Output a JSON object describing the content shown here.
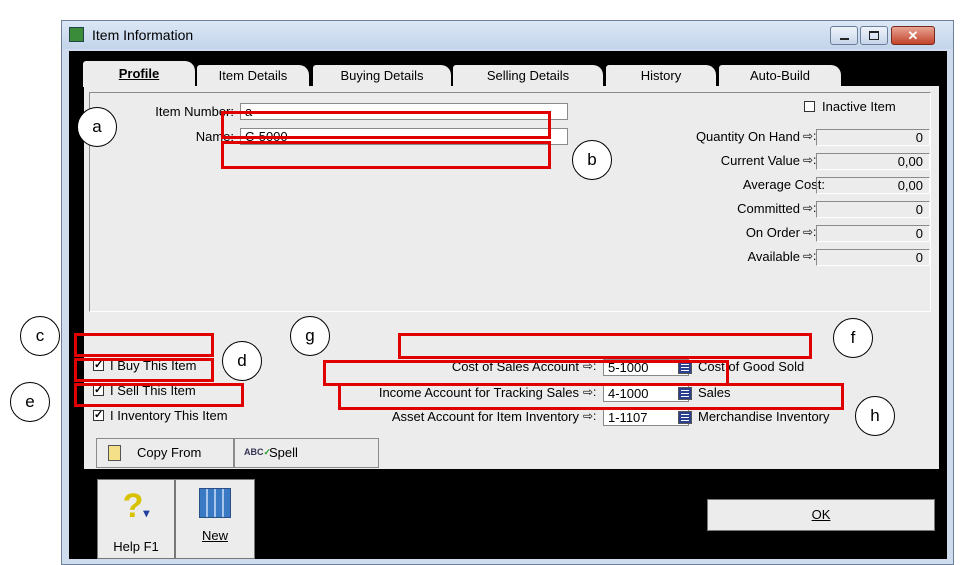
{
  "window": {
    "title": "Item Information"
  },
  "tabs": [
    {
      "label": "Profile"
    },
    {
      "label": "Item Details"
    },
    {
      "label": "Buying Details"
    },
    {
      "label": "Selling Details"
    },
    {
      "label": "History"
    },
    {
      "label": "Auto-Build"
    }
  ],
  "profile": {
    "item_number_label": "Item Number:",
    "item_number_value": "a",
    "name_label": "Name:",
    "name_value": "C-5000",
    "inactive_label": "Inactive Item",
    "inactive_checked": false
  },
  "stats": [
    {
      "label": "Quantity On Hand",
      "value": "0",
      "drilldown": true
    },
    {
      "label": "Current Value",
      "value": "0,00",
      "drilldown": true
    },
    {
      "label": "Average Cost:",
      "value": "0,00",
      "drilldown": false
    },
    {
      "label": "Committed",
      "value": "0",
      "drilldown": true
    },
    {
      "label": "On Order",
      "value": "0",
      "drilldown": true
    },
    {
      "label": "Available",
      "value": "0",
      "drilldown": true
    }
  ],
  "options": [
    {
      "label": "I Buy This Item",
      "checked": true
    },
    {
      "label": "I Sell This Item",
      "checked": true
    },
    {
      "label": "I Inventory This Item",
      "checked": true
    }
  ],
  "accounts": [
    {
      "label": "Cost of Sales Account",
      "number": "5-1000",
      "name": "Cost of Good Sold"
    },
    {
      "label": "Income Account for Tracking Sales",
      "number": "4-1000",
      "name": "Sales"
    },
    {
      "label": "Asset Account for Item Inventory",
      "number": "1-1107",
      "name": "Merchandise Inventory"
    }
  ],
  "buttons": {
    "copy_from": "Copy From",
    "spell": "Spell",
    "help": "Help F1",
    "new": "New",
    "ok": "OK"
  },
  "annotations": [
    "a",
    "b",
    "c",
    "d",
    "e",
    "f",
    "g",
    "h"
  ],
  "colors": {
    "highlight": "#e00000",
    "panel": "#ececec",
    "frame": "#cfdcee"
  },
  "icons": [
    "item-window-icon",
    "minimize-icon",
    "maximize-icon",
    "close-icon",
    "copy-icon",
    "spell-check-icon",
    "help-icon",
    "new-item-icon",
    "list-lookup-icon",
    "drilldown-arrow-icon"
  ]
}
